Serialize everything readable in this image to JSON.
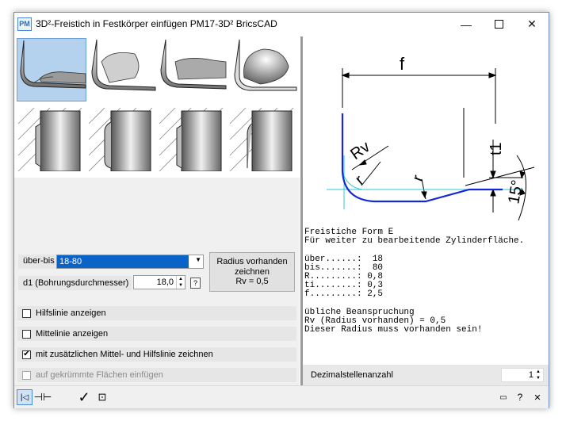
{
  "window": {
    "icon_text": "PM",
    "title": "3D²-Freistich in Festkörper einfügen  PM17-3D²  BricsCAD",
    "minimize": "—",
    "close": "✕"
  },
  "thumbnails": {
    "count": 8,
    "selected_index": 0
  },
  "drawing": {
    "label_f": "f",
    "label_t1": "t1",
    "label_rv": "Rv",
    "label_r": "r",
    "label_angle": "15°",
    "line_color": "#1428d8",
    "cyan_color": "#30c8d8"
  },
  "description": "Freistiche Form E\nFür weiter zu bearbeitende Zylinderfläche.\n\nüber......:  18\nbis.......:  80\nR.........: 0,8\nti........: 0,3\nf.........: 2,5\n\nübliche Beanspruchung\nRv (Radius vorhanden) = 0,5\nDieser Radius muss vorhanden sein!",
  "range": {
    "label": "über-bis",
    "value": "18-80"
  },
  "d1": {
    "label": "d1  (Bohrungsdurchmesser)",
    "value": "18,0",
    "help": "?"
  },
  "radius_button": {
    "line1": "Radius vorhanden",
    "line2": "zeichnen",
    "line3": "Rv = 0,5"
  },
  "options": [
    {
      "label": "Hilfslinie anzeigen",
      "checked": false,
      "mark": "",
      "enabled": true
    },
    {
      "label": "Mittelinie anzeigen",
      "checked": false,
      "mark": "",
      "enabled": true
    },
    {
      "label": "mit zusätzlichen Mittel- und Hilfslinie zeichnen",
      "checked": true,
      "mark": "✔",
      "enabled": true
    },
    {
      "label": "auf gekrümmte Flächen einfügen",
      "checked": false,
      "mark": "",
      "enabled": false
    }
  ],
  "decimals": {
    "label": "Dezimalstellenanzahl",
    "value": "1"
  },
  "bottom": {
    "ok": "✓",
    "help": "?",
    "close": "✕"
  }
}
